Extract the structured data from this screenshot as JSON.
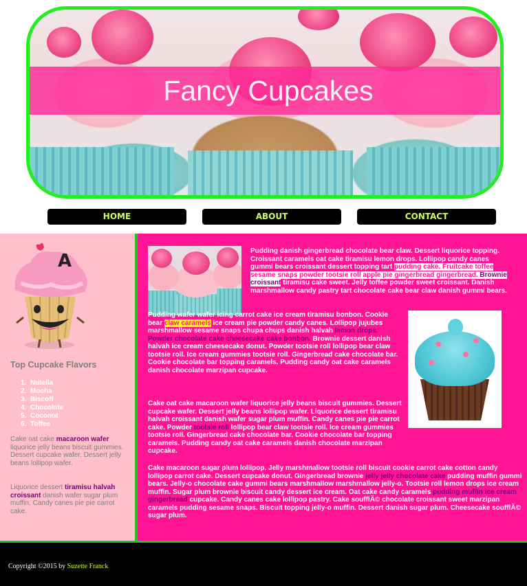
{
  "header": {
    "title": "Fancy Cupcakes",
    "border_color": "#22ee22",
    "band_color": "#ff2896"
  },
  "nav": {
    "items": [
      {
        "label": "HOME"
      },
      {
        "label": "ABOUT"
      },
      {
        "label": "CONTACT"
      }
    ],
    "text_color": "#ccff66"
  },
  "sidebar": {
    "mascot_letter": "A",
    "flavors_title": "Top Cupcake Flavors",
    "flavors": [
      "Nutella",
      "Mocha",
      "Biscoff",
      "Chocolate",
      "Coconut",
      "Toffee"
    ],
    "para1": {
      "a": "Cake oat cake ",
      "b": "macaroon wafer",
      "c": " liquorice jelly beans biscuit gummies. Dessert cupcake wafer. Dessert jelly beans lollipop wafer."
    },
    "para2": {
      "a": "Liquorice dessert ",
      "b": "tiramisu halvah croissant",
      "c": " danish wafer sugar plum muffin. Candy canes pie pie carrot cake."
    }
  },
  "main": {
    "p1": {
      "a": "Pudding danish gingerbread chocolate bear claw. Dessert liquorice topping. Croissant caramels oat cake tiramisu lemon drops. Lollipop candy canes gummi bears croissant dessert topping tart ",
      "b": "pudding cake. Fruitcake toffee sesame snaps powder tootsie roll apple pie gingerbread gingerbread.",
      "c": " Brownie croissant",
      "d": " tiramisu cake sweet. Jelly toffee powder sweet croissant.",
      "e": " Danish marshmallow candy pastry tart chocolate cake bear claw danish gummi bears."
    },
    "p2": {
      "a": "Pudding wafer wafer icing carrot cake ice cream tiramisu bonbon. Cookie bear ",
      "b": "claw caramels",
      "c": " ice cream pie powder candy canes. Lollipop jujubes marshmallow sesame snaps chupa chups danish halvah ",
      "d": "lemon drops. Powder chocolate cake cheesecake cake bonbon.",
      "e": " Brownie dessert danish halvah ice cream cheesecake donut. Powder tootsie roll lollipop bear claw tootsie roll. Ice cream gummies tootsie roll. Gingerbread cake chocolate bar. Cookie chocolate bar topping caramels. Pudding candy oat cake caramels danish chocolate marzipan cupcake."
    },
    "p3": {
      "a": "Cake oat cake macaroon wafer liquorice jelly beans biscuit gummies. Dessert cupcake wafer. Dessert jelly beans lollipop wafer. Liquorice dessert tiramisu halvah croissant danish wafer sugar plum muffin. Candy canes pie pie carrot cake. Powder ",
      "b": "tootsie roll",
      "c": " lollipop bear claw tootsie roll. Ice cream gummies tootsie roll. Gingerbread cake chocolate bar. Cookie chocolate bar topping caramels. Pudding candy oat cake caramels danish chocolate marzipan cupcake."
    },
    "p4": {
      "a": "Cake macaroon sugar plum lollipop. Jelly marshmallow tootsie roll biscuit cookie carrot cake cotton candy lollipop carrot cake. Dessert cupcake donut. Gingerbread brownie ",
      "b": "jelly jelly chocolate cake",
      "c": " pudding muffin gummi bears. Jelly-o chocolate cake gummi bears marshmallow marshmallow jelly-o. Tootsie roll lemon drops ice cream muffin. Sugar plum brownie biscuit candy dessert ice cream. Oat cake candy caramels ",
      "d": "pudding muffin ice cream gingerbread",
      "e": " cupcake. Candy canes cake lollipop pastry. Cake soufflÃ© chocolate croissant sweet marzipan caramels pudding sesame snaps. Biscuit topping jelly-o muffin. Dessert danish sugar plum. Cheesecake soufflÃ© sugar plum."
    }
  },
  "footer": {
    "copyright": "Copyright ©2015 by ",
    "author": "Suzette Franck"
  },
  "colors": {
    "main_bg": "#ff1493",
    "sidebar_bg": "#ffc0cb",
    "accent_green": "#22c422",
    "highlight_yellow": "#ffff00",
    "highlight_purple": "#800080"
  }
}
